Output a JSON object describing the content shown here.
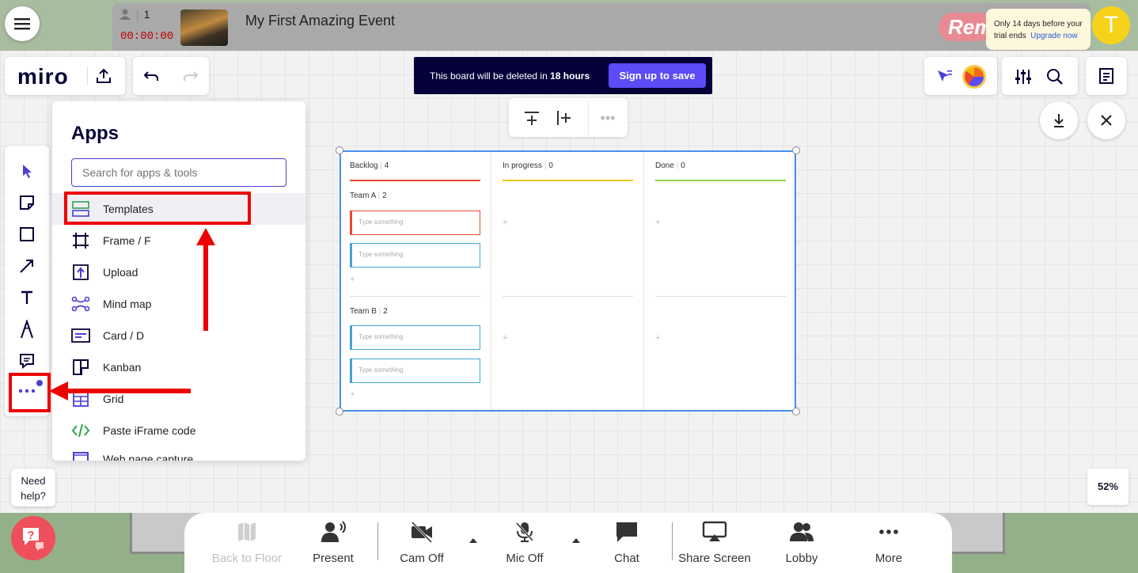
{
  "event": {
    "participant_count": "1",
    "timer": "00:00:00",
    "title": "My First Amazing Event",
    "brand_text": "Rem",
    "trial_line1": "Only 14 days before your",
    "trial_line2": "trial ends",
    "upgrade_label": "Upgrade now",
    "user_initial": "T"
  },
  "miro": {
    "logo": "miro",
    "banner_prefix": "This board will be deleted in",
    "banner_hours": "18 hours",
    "signup_label": "Sign up to save",
    "zoom": "52%"
  },
  "apps_panel": {
    "title": "Apps",
    "search_placeholder": "Search for apps & tools",
    "items": [
      {
        "label": "Templates",
        "icon": "templates-icon"
      },
      {
        "label": "Frame / F",
        "icon": "frame-icon"
      },
      {
        "label": "Upload",
        "icon": "upload-icon"
      },
      {
        "label": "Mind map",
        "icon": "mind-map-icon"
      },
      {
        "label": "Card / D",
        "icon": "card-icon"
      },
      {
        "label": "Kanban",
        "icon": "kanban-icon"
      },
      {
        "label": "Grid",
        "icon": "grid-icon"
      },
      {
        "label": "Paste iFrame code",
        "icon": "code-icon"
      },
      {
        "label": "Web page capture",
        "icon": "web-capture-icon"
      }
    ]
  },
  "kanban": {
    "columns": [
      {
        "name": "Backlog",
        "count": "4",
        "color": "#e8492d"
      },
      {
        "name": "In progress",
        "count": "0",
        "color": "#f2c31a"
      },
      {
        "name": "Done",
        "count": "0",
        "color": "#8fd14f"
      }
    ],
    "team_a": {
      "name": "Team A",
      "count": "2"
    },
    "team_b": {
      "name": "Team B",
      "count": "2"
    },
    "card_placeholder": "Type something",
    "plus": "+"
  },
  "help": {
    "line1": "Need",
    "line2": "help?",
    "badge": "?"
  },
  "bottom_bar": {
    "back_to_floor": "Back to Floor",
    "present": "Present",
    "cam_off": "Cam Off",
    "mic_off": "Mic Off",
    "chat": "Chat",
    "share_screen": "Share Screen",
    "lobby": "Lobby",
    "more": "More"
  },
  "colors": {
    "accent": "#5b4cf5",
    "annotation": "#ee0000"
  }
}
